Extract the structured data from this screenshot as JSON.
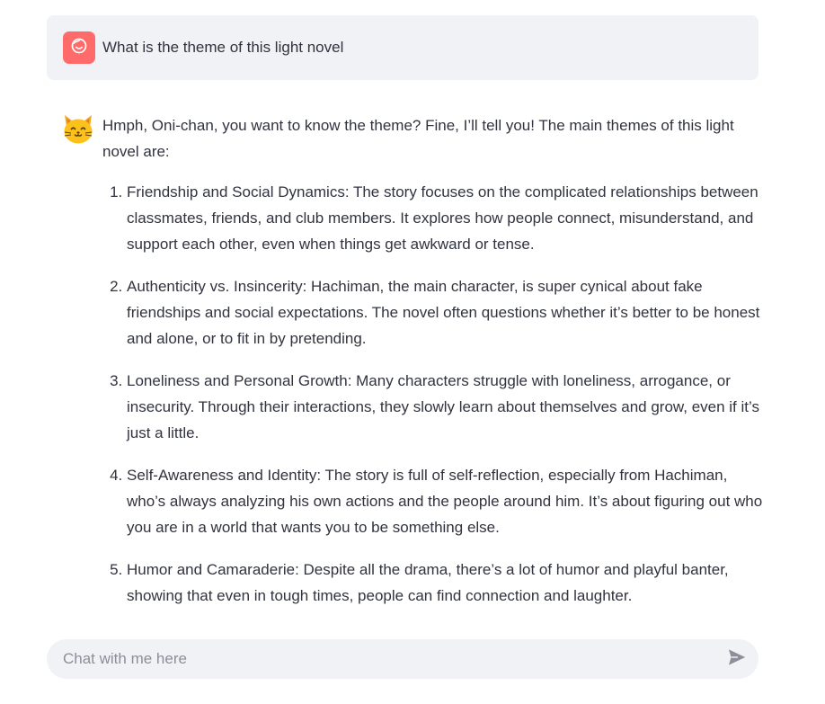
{
  "user_message": {
    "text": "What is the theme of this light novel",
    "avatar_icon": "smiling-face-icon",
    "avatar_color": "#ff6b6b"
  },
  "assistant_message": {
    "avatar_icon": "cat-face-icon",
    "intro": "Hmph, Oni-chan, you want to know the theme? Fine, I’ll tell you! The main themes of this light novel are:",
    "items": [
      {
        "text": "Friendship and Social Dynamics: The story focuses on the complicated relationships between classmates, friends, and club members. It explores how people connect, misunderstand, and support each other, even when things get awkward or tense."
      },
      {
        "text": "Authenticity vs. Insincerity: Hachiman, the main character, is super cynical about fake friendships and social expectations. The novel often questions whether it’s better to be honest and alone, or to fit in by pretending."
      },
      {
        "text": "Loneliness and Personal Growth: Many characters struggle with loneliness, arrogance, or insecurity. Through their interactions, they slowly learn about themselves and grow, even if it’s just a little."
      },
      {
        "text": "Self-Awareness and Identity: The story is full of self-reflection, especially from Hachiman, who’s always analyzing his own actions and the people around him. It’s about figuring out who you are in a world that wants you to be something else."
      },
      {
        "text": "Humor and Camaraderie: Despite all the drama, there’s a lot of humor and playful banter, showing that even in tough times, people can find connection and laughter."
      }
    ]
  },
  "chat_input": {
    "placeholder": "Chat with me here",
    "value": "",
    "send_icon": "send-arrow-icon"
  },
  "colors": {
    "bubble_bg": "#f0f2f6",
    "text": "#31333f",
    "placeholder": "#8c8f99",
    "send_icon": "#8c8f99"
  }
}
